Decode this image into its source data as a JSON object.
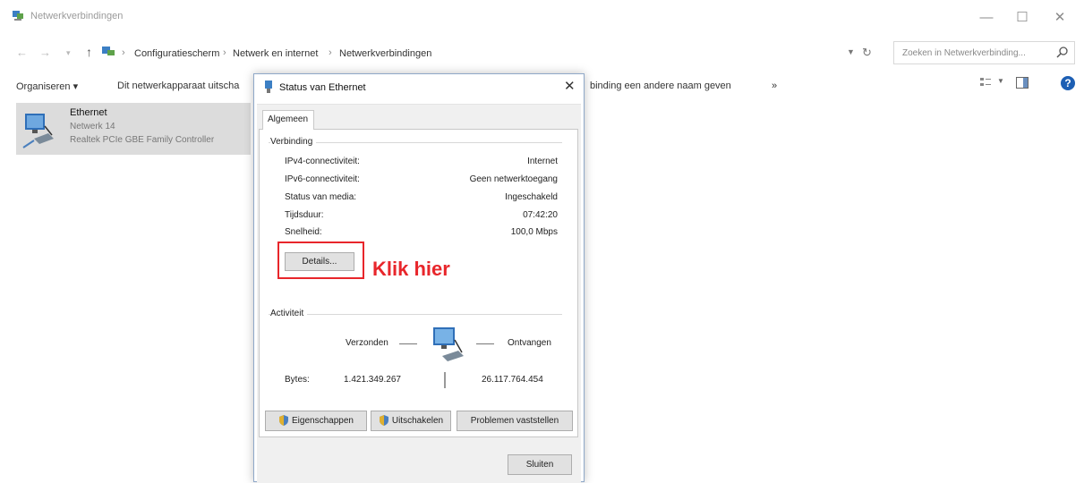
{
  "window": {
    "title": "Netwerkverbindingen",
    "buttons": {
      "minimize": "—",
      "maximize": "☐",
      "close": "✕"
    }
  },
  "address": {
    "crumbs": [
      "Configuratiescherm",
      "Netwerk en internet",
      "Netwerkverbindingen"
    ],
    "separator": "›",
    "search_placeholder": "Zoeken in Netwerkverbinding..."
  },
  "toolbar": {
    "organize": "Organiseren ▾",
    "disable_device": "Dit netwerkapparaat uitscha",
    "rename": "binding een andere naam geven",
    "more": "»"
  },
  "connection": {
    "name": "Ethernet",
    "network": "Netwerk  14",
    "controller": "Realtek PCIe GBE Family Controller"
  },
  "dialog": {
    "title": "Status van Ethernet",
    "tab": "Algemeen",
    "group_connection": "Verbinding",
    "rows": [
      {
        "label": "IPv4-connectiviteit:",
        "value": "Internet"
      },
      {
        "label": "IPv6-connectiviteit:",
        "value": "Geen netwerktoegang"
      },
      {
        "label": "Status van media:",
        "value": "Ingeschakeld"
      },
      {
        "label": "Tijdsduur:",
        "value": "07:42:20"
      },
      {
        "label": "Snelheid:",
        "value": "100,0 Mbps"
      }
    ],
    "details_button": "Details...",
    "annotation": "Klik hier",
    "group_activity": "Activiteit",
    "sent_label": "Verzonden",
    "received_label": "Ontvangen",
    "bytes_label": "Bytes:",
    "bytes_sent": "1.421.349.267",
    "bytes_received": "26.117.764.454",
    "btn_properties": "Eigenschappen",
    "btn_disable": "Uitschakelen",
    "btn_diagnose": "Problemen vaststellen",
    "btn_close": "Sluiten"
  },
  "colors": {
    "annotation": "#e8262b",
    "selection": "#dcdcdc",
    "help": "#1d5fb4"
  }
}
